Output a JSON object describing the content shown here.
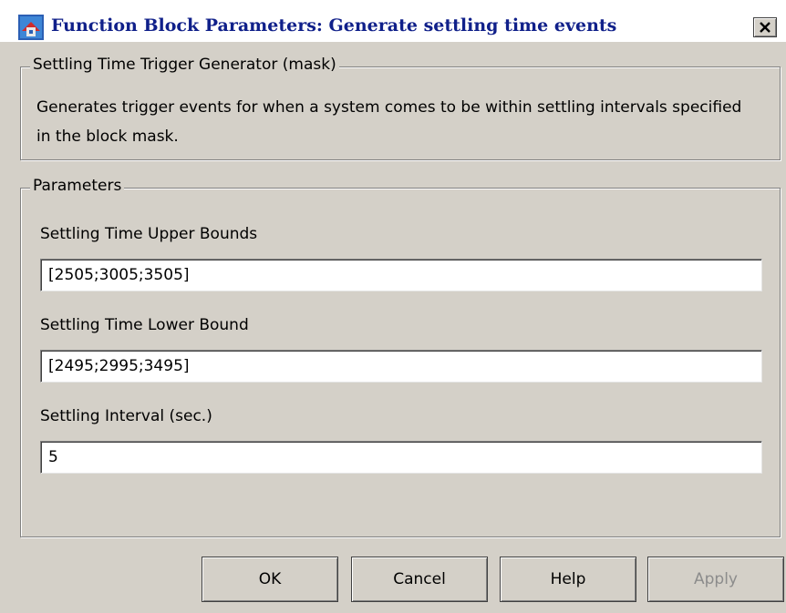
{
  "window": {
    "title": "Function Block Parameters: Generate settling time events",
    "close_glyph": "X",
    "title_color": "#10208a"
  },
  "mask_group": {
    "legend": "Settling Time Trigger Generator (mask)",
    "description": "Generates trigger events for when a system comes to be within settling intervals specified in the block mask."
  },
  "parameters": {
    "legend": "Parameters",
    "fields": [
      {
        "label": "Settling Time Upper Bounds",
        "value": "[2505;3005;3505]"
      },
      {
        "label": "Settling Time Lower Bound",
        "value": "[2495;2995;3495]"
      },
      {
        "label": "Settling Interval (sec.)",
        "value": "5"
      }
    ]
  },
  "buttons": {
    "ok": "OK",
    "cancel": "Cancel",
    "help": "Help",
    "apply": "Apply"
  },
  "colors": {
    "dialog_bg": "#d4d0c8",
    "disabled_text": "#8c8c8c"
  },
  "icons": {
    "app": "simulink-block-icon",
    "close": "close-icon"
  }
}
